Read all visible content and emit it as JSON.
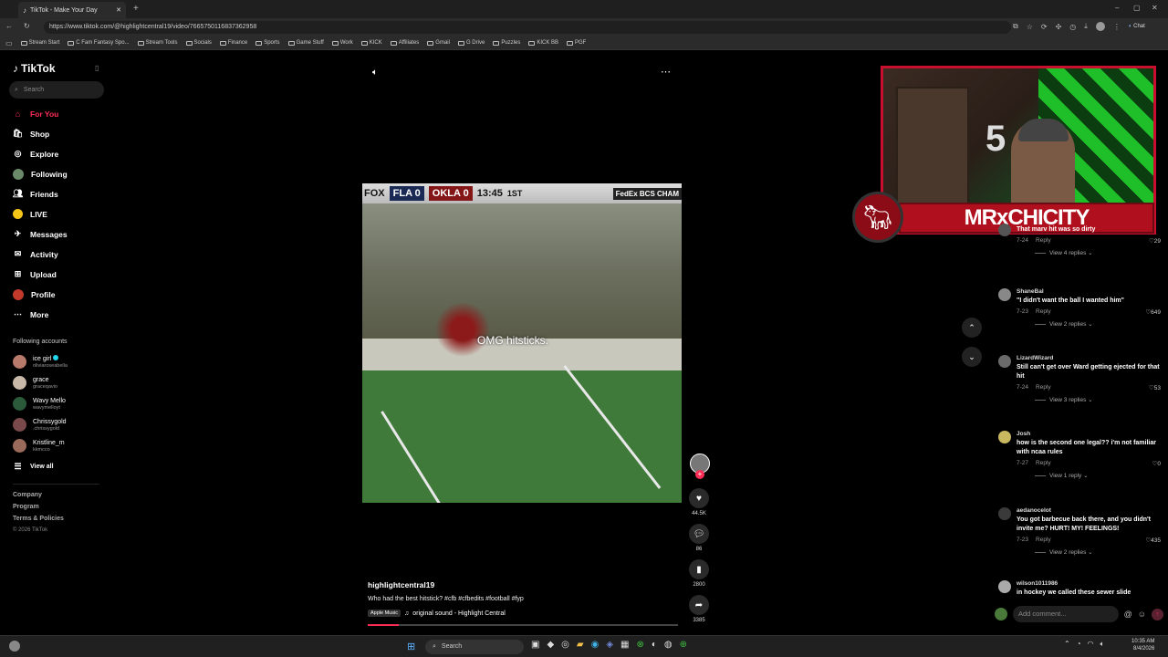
{
  "browser": {
    "tab_title": "TikTok - Make Your Day",
    "url": "https://www.tiktok.com/@highlightcentral19/video/7665750116837362958",
    "chat_label": "Chat",
    "bookmarks": [
      "Stream Start",
      "C Fam Fantasy Spo...",
      "Stream Tools",
      "Socials",
      "Finance",
      "Sports",
      "Game Stuff",
      "Work",
      "KICK",
      "Affiliates",
      "Gmail",
      "G Drive",
      "Puzzles",
      "KICK BB",
      "PGF"
    ]
  },
  "sidebar": {
    "logo": "TikTok",
    "search_placeholder": "Search",
    "nav": [
      "For You",
      "Shop",
      "Explore",
      "Following",
      "Friends",
      "LIVE",
      "Messages",
      "Activity",
      "Upload",
      "Profile",
      "More"
    ],
    "following_title": "Following accounts",
    "accounts": [
      {
        "name": "ice girl",
        "handle": "oliviaroseabella"
      },
      {
        "name": "grace",
        "handle": "graceqavio"
      },
      {
        "name": "Wavy Mello",
        "handle": "wavymelloyt"
      },
      {
        "name": "Chrissygold",
        "handle": ".chrissygold"
      },
      {
        "name": "Kristline_m",
        "handle": "kkmcco"
      }
    ],
    "view_all": "View all",
    "footer": [
      "Company",
      "Program",
      "Terms & Policies"
    ],
    "copyright": "© 2026 TikTok"
  },
  "video": {
    "score_fox": "FOX",
    "score_fla": "FLA",
    "score_fla_val": "0",
    "score_okla": "OKLA",
    "score_okla_val": "0",
    "clock": "13:45",
    "quarter": "1ST",
    "score_right": "FedEx BCS CHAM",
    "caption": "OMG hitsticks.",
    "author": "highlightcentral19",
    "description": "Who had the best hitstick? #cfb #cfbedits #football #fyp",
    "music_badge": "Apple Music",
    "sound": "original sound - Highlight Central",
    "likes": "44.5K",
    "comments": "86",
    "saves": "2800",
    "shares": "3385",
    "progress": 0.1
  },
  "stream_overlay": {
    "name": "MRxCHICITY",
    "badge": "5"
  },
  "comments": [
    {
      "user": "",
      "text": "That marv hit was so dirty",
      "date": "7-24",
      "likes": "29",
      "replies": "View 4 replies"
    },
    {
      "user": "ShaneBal",
      "text": "\"I didn't want the ball I wanted him\"",
      "date": "7-23",
      "likes": "649",
      "replies": "View 2 replies"
    },
    {
      "user": "LizardWizard",
      "text": "Still can't get over Ward getting ejected for that hit",
      "date": "7-24",
      "likes": "53",
      "replies": "View 3 replies"
    },
    {
      "user": "Josh",
      "text": "how is the second one legal?? i'm not familiar with ncaa rules",
      "date": "7-27",
      "likes": "0",
      "replies": "View 1 reply"
    },
    {
      "user": "aedanocelot",
      "text": "You got barbecue back there, and you didn't invite me? HURT! MY! FEELINGS!",
      "date": "7-23",
      "likes": "435",
      "replies": "View 2 replies"
    },
    {
      "user": "wilson1011986",
      "text": "in hockey we called these sewer slide",
      "date": "",
      "likes": "",
      "replies": ""
    }
  ],
  "reply_label": "Reply",
  "comment_placeholder": "Add comment...",
  "taskbar": {
    "search": "Search",
    "time": "10:35 AM",
    "date": "8/4/2026"
  },
  "colors": {
    "accent": "#fe2c55",
    "overlay_red": "#c8102e"
  }
}
